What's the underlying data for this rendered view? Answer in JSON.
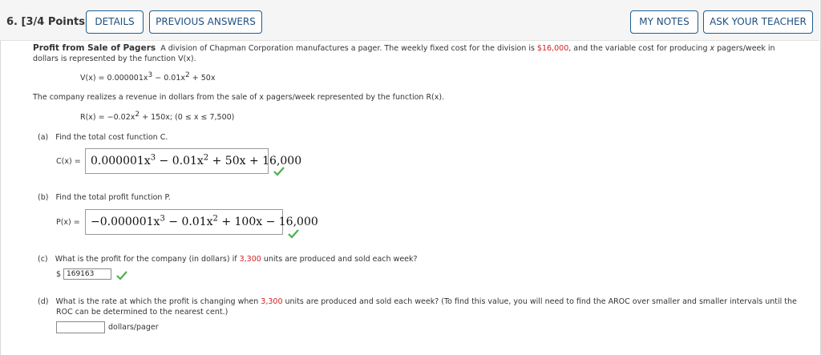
{
  "question": {
    "number": "6.",
    "points": "[3/4 Points]",
    "buttons": {
      "details": "DETAILS",
      "previous_answers": "PREVIOUS ANSWERS",
      "my_notes": "MY NOTES",
      "ask_teacher": "ASK YOUR TEACHER"
    }
  },
  "problem": {
    "title": "Profit from Sale of Pagers",
    "intro_1": "A division of Chapman Corporation manufactures a pager. The weekly fixed cost for the division is ",
    "fixed_cost": "$16,000",
    "intro_2": ", and the variable cost for producing ",
    "x_var": "x",
    "intro_3": " pagers/week in",
    "intro_line2": "dollars is represented by the function V(x).",
    "v_function": {
      "lhs": "V(x) = 0.000001x",
      "exp1": "3",
      "mid": " − 0.01x",
      "exp2": "2",
      "rhs": " + 50x"
    },
    "revenue_sentence": "The company realizes a revenue in dollars from the sale of x pagers/week represented by the function R(x).",
    "r_function": {
      "lhs": "R(x) = −0.02x",
      "exp": "2",
      "rhs": " + 150x;  (0 ≤ x ≤ 7,500)"
    }
  },
  "parts": {
    "a": {
      "label": "(a)",
      "prompt": "Find the total cost function C.",
      "answer_label": "C(x) =",
      "answer": {
        "p1": "0.000001x",
        "e1": "3",
        "p2": " − 0.01x",
        "e2": "2",
        "p3": " + 50x + 16,000"
      },
      "status": "correct"
    },
    "b": {
      "label": "(b)",
      "prompt": "Find the total profit function P.",
      "answer_label": "P(x) =",
      "answer": {
        "p1": "−0.000001x",
        "e1": "3",
        "p2": " − 0.01x",
        "e2": "2",
        "p3": " + 100x − 16,000"
      },
      "status": "correct"
    },
    "c": {
      "label": "(c)",
      "prompt_1": "What is the profit for the company (in dollars) if ",
      "units": "3,300",
      "prompt_2": " units are produced and sold each week?",
      "currency": "$",
      "answer": "169163",
      "status": "correct"
    },
    "d": {
      "label": "(d)",
      "prompt_1": "What is the rate at which the profit is changing when ",
      "units": "3,300",
      "prompt_2": " units are produced and sold each week? (To find this value, you will need to find the AROC over smaller and smaller intervals until the",
      "prompt_line2": "ROC can be determined to the nearest cent.)",
      "answer": "",
      "unit_label": "dollars/pager"
    }
  },
  "colors": {
    "accent": "#1f5d8f",
    "highlight": "#d62020",
    "check": "#4caf50"
  }
}
